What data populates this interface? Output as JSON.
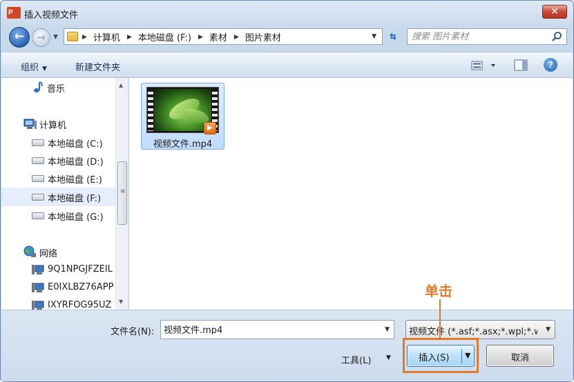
{
  "window": {
    "title": "插入视频文件",
    "app_icon_text": "P",
    "close_label": "✕"
  },
  "navigation": {
    "back_glyph": "←",
    "forward_glyph": "→",
    "breadcrumbs": [
      "计算机",
      "本地磁盘 (F:)",
      "素材",
      "图片素材"
    ],
    "search_placeholder": "搜索 图片素材"
  },
  "toolbar": {
    "organize_label": "组织",
    "new_folder_label": "新建文件夹",
    "help_label": "?"
  },
  "nav_pane": {
    "items": [
      {
        "label": "音乐",
        "icon": "music-icon"
      },
      {
        "label": "计算机",
        "icon": "computer-icon"
      },
      {
        "label": "本地磁盘 (C:)",
        "icon": "drive-icon"
      },
      {
        "label": "本地磁盘 (D:)",
        "icon": "drive-icon"
      },
      {
        "label": "本地磁盘 (E:)",
        "icon": "drive-icon"
      },
      {
        "label": "本地磁盘 (F:)",
        "icon": "drive-icon",
        "selected": true
      },
      {
        "label": "本地磁盘 (G:)",
        "icon": "drive-icon"
      },
      {
        "label": "网络",
        "icon": "network-icon"
      },
      {
        "label": "9Q1NPGJFZEIL",
        "icon": "network-computer-icon"
      },
      {
        "label": "E0IXLBZ76APP",
        "icon": "network-computer-icon"
      },
      {
        "label": "IXYRFOG95UZ",
        "icon": "network-computer-icon"
      }
    ]
  },
  "files": [
    {
      "name": "视频文件.mp4",
      "type": "video",
      "selected": true
    }
  ],
  "bottom": {
    "filename_label": "文件名(N):",
    "filename_value": "视频文件.mp4",
    "filetype_value": "视频文件 (*.asf;*.asx;*.wpl;*.wm",
    "tools_label": "工具(L)",
    "insert_label": "插入(S)",
    "cancel_label": "取消"
  },
  "annotation": {
    "callout_text": "单击",
    "color": "#e07a2c"
  }
}
